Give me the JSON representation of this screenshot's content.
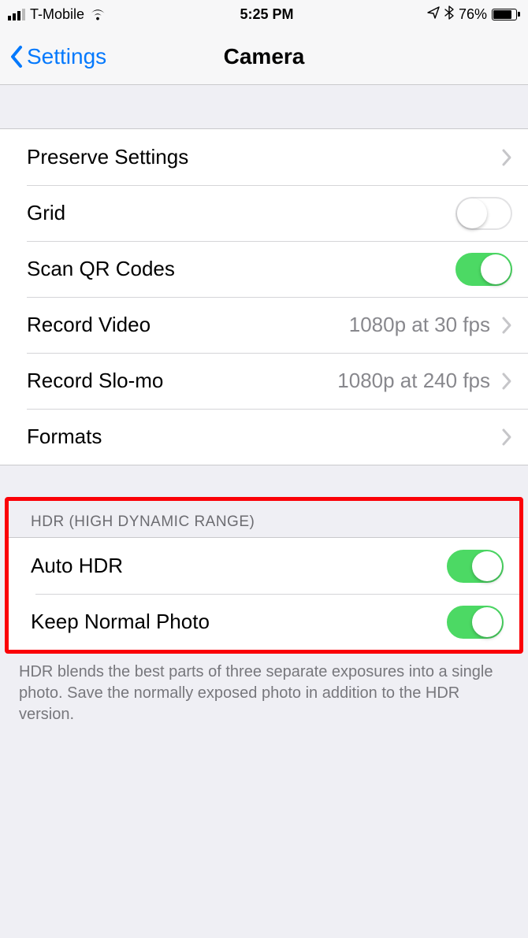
{
  "status_bar": {
    "carrier": "T-Mobile",
    "time": "5:25 PM",
    "battery_pct": "76%"
  },
  "nav": {
    "back_label": "Settings",
    "title": "Camera"
  },
  "rows": {
    "preserve_settings": "Preserve Settings",
    "grid": "Grid",
    "scan_qr": "Scan QR Codes",
    "record_video": "Record Video",
    "record_video_detail": "1080p at 30 fps",
    "record_slomo": "Record Slo-mo",
    "record_slomo_detail": "1080p at 240 fps",
    "formats": "Formats"
  },
  "hdr_section": {
    "header": "HDR (HIGH DYNAMIC RANGE)",
    "auto_hdr": "Auto HDR",
    "keep_normal": "Keep Normal Photo",
    "footer": "HDR blends the best parts of three separate exposures into a single photo. Save the normally exposed photo in addition to the HDR version."
  }
}
